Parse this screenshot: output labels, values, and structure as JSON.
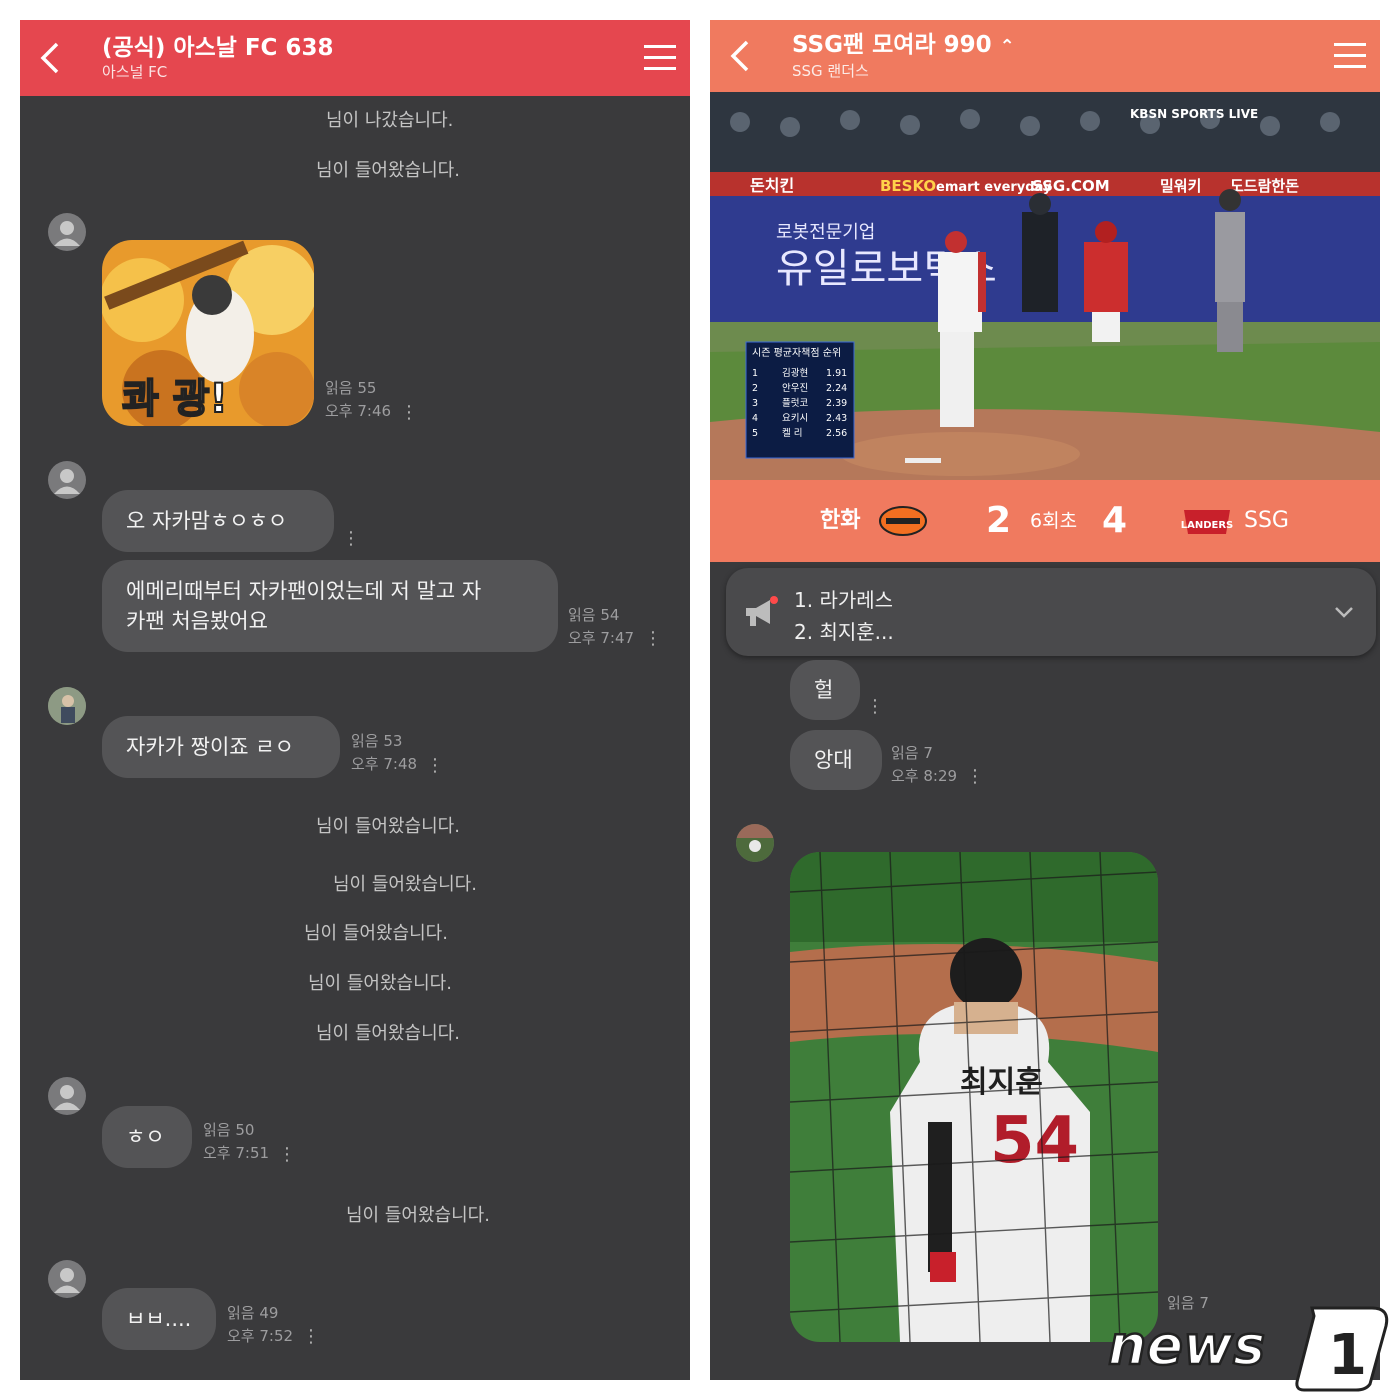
{
  "left": {
    "header": {
      "title": "(공식) 아스날 FC 638",
      "subtitle": "아스널 FC"
    },
    "system_messages": [
      "님이 나갔습니다.",
      "님이 들어왔습니다.",
      "님이 들어왔습니다.",
      "님이 들어왔습니다.",
      "님이 들어왔습니다.",
      "님이 들어왔습니다.",
      "님이 들어왔습니다.",
      "님이 들어왔습니다."
    ],
    "sticker": {
      "text": "콰 광!",
      "read": "읽음 55",
      "time": "오후 7:46"
    },
    "messages": [
      {
        "text": "오 자카맘ㅎㅇㅎㅇ"
      },
      {
        "line1": "에메리때부터 자카팬이었는데 저 말고 자",
        "line2": "카팬 처음봤어요",
        "read": "읽음 54",
        "time": "오후 7:47"
      },
      {
        "text": "자카가 짱이죠 ㄹㅇ",
        "read": "읽음 53",
        "time": "오후 7:48"
      },
      {
        "text": "ㅎㅇ",
        "read": "읽음 50",
        "time": "오후 7:51"
      },
      {
        "text": "ㅂㅂ....",
        "read": "읽음 49",
        "time": "오후 7:52"
      }
    ]
  },
  "right": {
    "header": {
      "title": "SSG팬 모여라 990",
      "subtitle": "SSG 랜더스"
    },
    "broadcast": {
      "ads": [
        "돈치킨",
        "BESKO",
        "emart everyday",
        "SSG.COM",
        "밀워키",
        "도드람한돈"
      ],
      "sponsor": "유일로보틱스",
      "sponsor_sub": "로봇전문기업",
      "channel": "KBSN SPORTS LIVE",
      "board_title": "시즌 평균자책점 순위",
      "board_rows": [
        {
          "rank": "1",
          "name": "김광현",
          "era": "1.91"
        },
        {
          "rank": "2",
          "name": "안우진",
          "era": "2.24"
        },
        {
          "rank": "3",
          "name": "플럿코",
          "era": "2.39"
        },
        {
          "rank": "4",
          "name": "요키시",
          "era": "2.43"
        },
        {
          "rank": "5",
          "name": "켈 리",
          "era": "2.56"
        }
      ]
    },
    "scoreboard": {
      "away": "한화",
      "away_score": "2",
      "inning": "6회초",
      "home_score": "4",
      "home": "SSG",
      "home_logo": "LANDERS"
    },
    "notice": {
      "line1": "1. 라가레스",
      "line2": "2. 최지훈..."
    },
    "messages": [
      {
        "text": "헐"
      },
      {
        "text": "앙대",
        "read": "읽음 7",
        "time": "오후 8:29"
      }
    ],
    "photo": {
      "jersey_name": "최지훈",
      "jersey_number": "54",
      "read": "읽음 7"
    }
  },
  "watermark": "news1",
  "colors": {
    "left_header": "#e5474f",
    "right_header": "#f07a5f",
    "chat_bg": "#3a3a3c",
    "bubble": "#545456"
  }
}
